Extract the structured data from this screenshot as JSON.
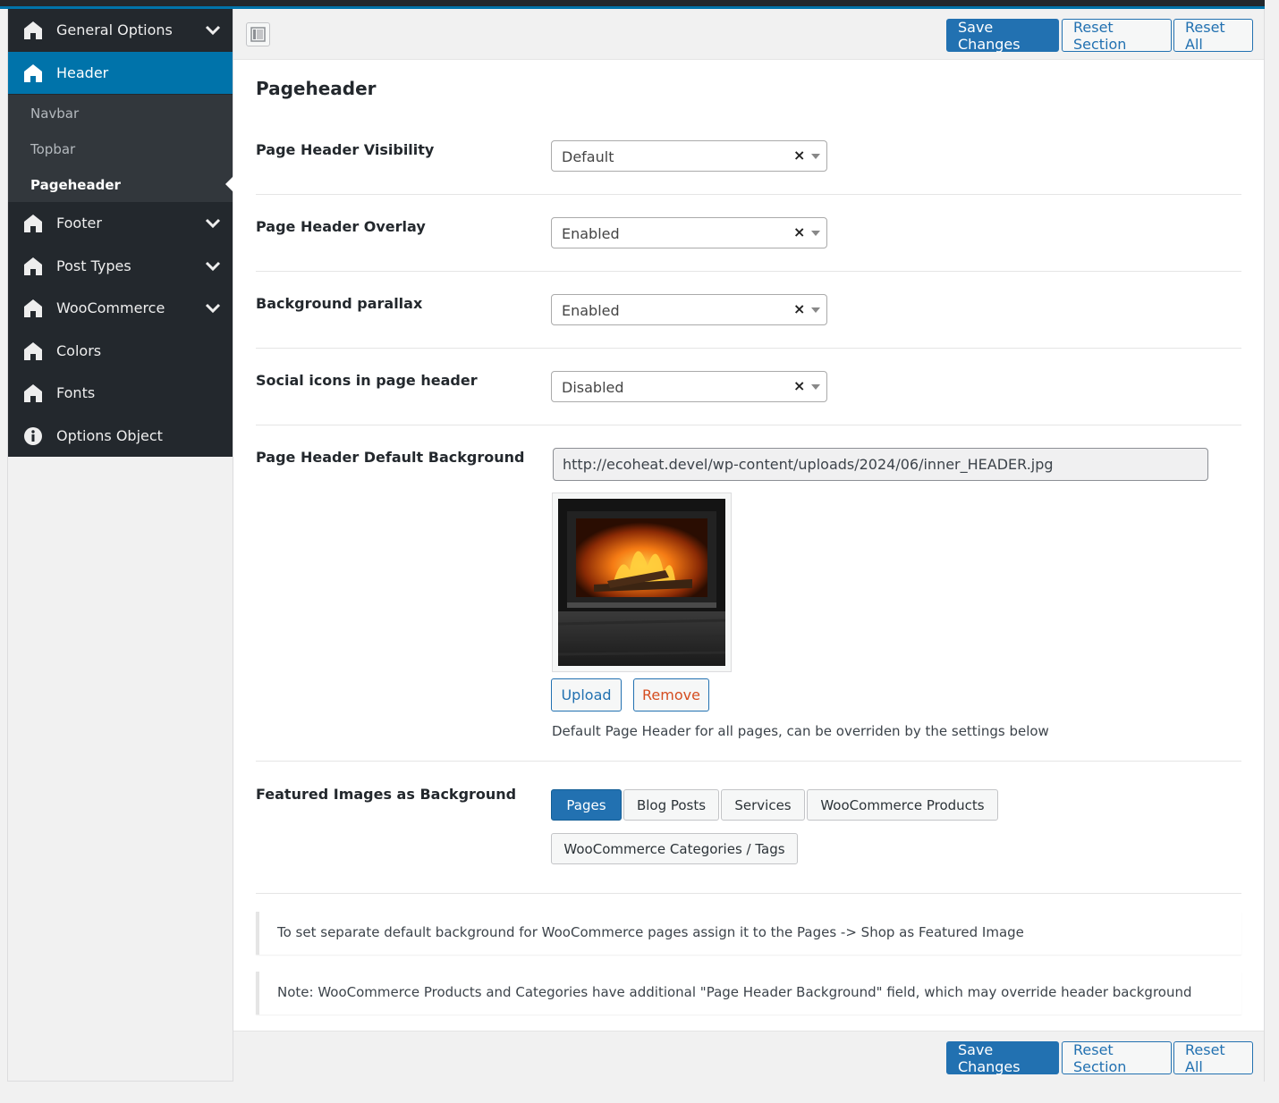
{
  "sidebar": {
    "items": [
      {
        "label": "General Options",
        "icon": "home-icon",
        "has_chevron": true
      },
      {
        "label": "Header",
        "icon": "home-icon",
        "active": true
      },
      {
        "label": "Footer",
        "icon": "home-icon",
        "has_chevron": true
      },
      {
        "label": "Post Types",
        "icon": "home-icon",
        "has_chevron": true
      },
      {
        "label": "WooCommerce",
        "icon": "home-icon",
        "has_chevron": true
      },
      {
        "label": "Colors",
        "icon": "home-icon"
      },
      {
        "label": "Fonts",
        "icon": "home-icon"
      },
      {
        "label": "Options Object",
        "icon": "info-icon"
      }
    ],
    "sub_items": [
      {
        "label": "Navbar"
      },
      {
        "label": "Topbar"
      },
      {
        "label": "Pageheader",
        "active": true
      }
    ]
  },
  "toolbar": {
    "save_label": "Save Changes",
    "reset_section_label": "Reset Section",
    "reset_all_label": "Reset All"
  },
  "section": {
    "title": "Pageheader",
    "fields": [
      {
        "label": "Page Header Visibility",
        "value": "Default"
      },
      {
        "label": "Page Header Overlay",
        "value": "Enabled"
      },
      {
        "label": "Background parallax",
        "value": "Enabled"
      },
      {
        "label": "Social icons in page header",
        "value": "Disabled"
      }
    ],
    "background": {
      "label": "Page Header Default Background",
      "url": "http://ecoheat.devel/wp-content/uploads/2024/06/inner_HEADER.jpg",
      "upload_label": "Upload",
      "remove_label": "Remove",
      "description": "Default Page Header for all pages, can be overriden by the settings below"
    },
    "featured": {
      "label": "Featured Images as Background",
      "options": [
        {
          "label": "Pages",
          "selected": true
        },
        {
          "label": "Blog Posts",
          "selected": false
        },
        {
          "label": "Services",
          "selected": false
        },
        {
          "label": "WooCommerce Products",
          "selected": false
        },
        {
          "label": "WooCommerce Categories / Tags",
          "selected": false
        }
      ]
    },
    "notices": [
      "To set separate default background for WooCommerce pages assign it to the Pages -> Shop as Featured Image",
      "Note: WooCommerce Products and Categories have additional \"Page Header Background\" field, which may override header background"
    ]
  },
  "colors": {
    "accent": "#0073aa",
    "primary_button": "#2271b1",
    "sidebar_bg": "#23282d",
    "remove_text": "#d54e21"
  }
}
